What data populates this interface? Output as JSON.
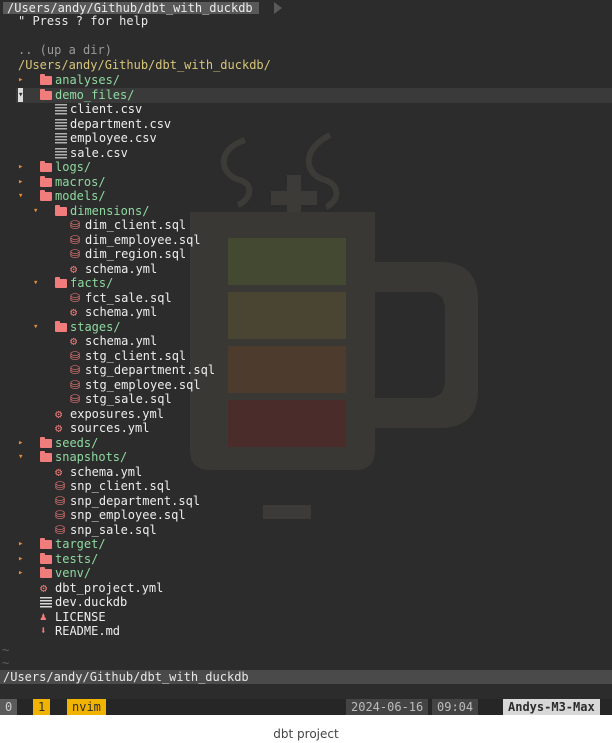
{
  "tab_title": "/Users/andy/Github/dbt_with_duckdb",
  "help_line": "\" Press ? for help",
  "updir": ".. (up a dir)",
  "root_path": "/Users/andy/Github/dbt_with_duckdb/",
  "tree": [
    {
      "label": "analyses/",
      "kind": "dir",
      "depth": 0,
      "state": "collapsed"
    },
    {
      "label": "demo_files/",
      "kind": "dir",
      "depth": 0,
      "state": "expanded",
      "cursor": true
    },
    {
      "label": "client.csv",
      "kind": "csv",
      "depth": 1
    },
    {
      "label": "department.csv",
      "kind": "csv",
      "depth": 1
    },
    {
      "label": "employee.csv",
      "kind": "csv",
      "depth": 1
    },
    {
      "label": "sale.csv",
      "kind": "csv",
      "depth": 1
    },
    {
      "label": "logs/",
      "kind": "dir",
      "depth": 0,
      "state": "collapsed"
    },
    {
      "label": "macros/",
      "kind": "dir",
      "depth": 0,
      "state": "collapsed"
    },
    {
      "label": "models/",
      "kind": "dir",
      "depth": 0,
      "state": "expanded"
    },
    {
      "label": "dimensions/",
      "kind": "dir",
      "depth": 1,
      "state": "expanded"
    },
    {
      "label": "dim_client.sql",
      "kind": "db",
      "depth": 2
    },
    {
      "label": "dim_employee.sql",
      "kind": "db",
      "depth": 2
    },
    {
      "label": "dim_region.sql",
      "kind": "db",
      "depth": 2
    },
    {
      "label": "schema.yml",
      "kind": "gear",
      "depth": 2
    },
    {
      "label": "facts/",
      "kind": "dir",
      "depth": 1,
      "state": "expanded"
    },
    {
      "label": "fct_sale.sql",
      "kind": "db",
      "depth": 2
    },
    {
      "label": "schema.yml",
      "kind": "gear",
      "depth": 2
    },
    {
      "label": "stages/",
      "kind": "dir",
      "depth": 1,
      "state": "expanded"
    },
    {
      "label": "schema.yml",
      "kind": "gear",
      "depth": 2
    },
    {
      "label": "stg_client.sql",
      "kind": "db",
      "depth": 2
    },
    {
      "label": "stg_department.sql",
      "kind": "db",
      "depth": 2
    },
    {
      "label": "stg_employee.sql",
      "kind": "db",
      "depth": 2
    },
    {
      "label": "stg_sale.sql",
      "kind": "db",
      "depth": 2
    },
    {
      "label": "exposures.yml",
      "kind": "gear",
      "depth": 1
    },
    {
      "label": "sources.yml",
      "kind": "gear",
      "depth": 1
    },
    {
      "label": "seeds/",
      "kind": "dir",
      "depth": 0,
      "state": "collapsed"
    },
    {
      "label": "snapshots/",
      "kind": "dir",
      "depth": 0,
      "state": "expanded"
    },
    {
      "label": "schema.yml",
      "kind": "gear",
      "depth": 1
    },
    {
      "label": "snp_client.sql",
      "kind": "db",
      "depth": 1
    },
    {
      "label": "snp_department.sql",
      "kind": "db",
      "depth": 1
    },
    {
      "label": "snp_employee.sql",
      "kind": "db",
      "depth": 1
    },
    {
      "label": "snp_sale.sql",
      "kind": "db",
      "depth": 1
    },
    {
      "label": "target/",
      "kind": "dir",
      "depth": 0,
      "state": "collapsed"
    },
    {
      "label": "tests/",
      "kind": "dir",
      "depth": 0,
      "state": "collapsed"
    },
    {
      "label": "venv/",
      "kind": "dir",
      "depth": 0,
      "state": "collapsed"
    },
    {
      "label": "dbt_project.yml",
      "kind": "gear",
      "depth": 0
    },
    {
      "label": "dev.duckdb",
      "kind": "duck",
      "depth": 0
    },
    {
      "label": "LICENSE",
      "kind": "license",
      "depth": 0
    },
    {
      "label": "README.md",
      "kind": "readme",
      "depth": 0
    }
  ],
  "tilde": "~",
  "status_path": "/Users/andy/Github/dbt_with_duckdb",
  "tmux": {
    "session": "0",
    "window_index": "1",
    "window_name": "nvim",
    "date": "2024-06-16",
    "time": "09:04",
    "host": "Andys-M3-Max"
  },
  "caption": "dbt project",
  "colors": {
    "background": "#2c2c2c",
    "dir": "#8fd9a0",
    "icon": "#f07c7c",
    "arrow": "#e38a3c",
    "tmux_accent": "#f0b400"
  }
}
